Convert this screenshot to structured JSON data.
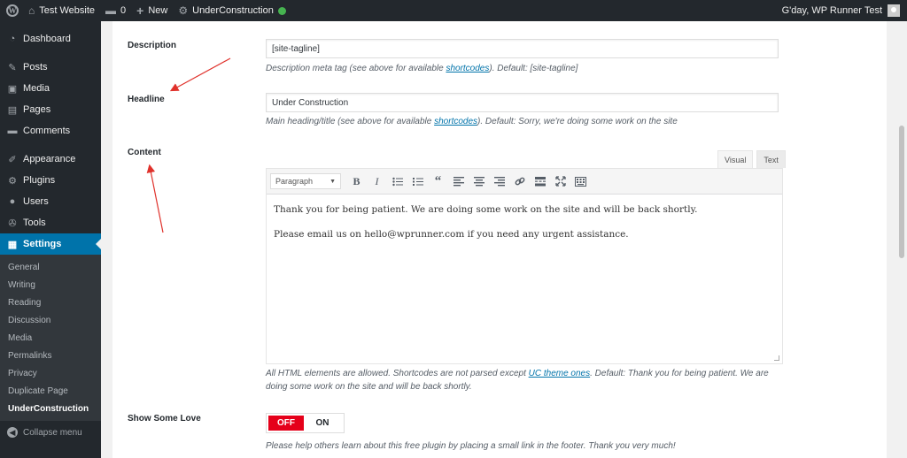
{
  "adminbar": {
    "site_name": "Test Website",
    "comments_count": "0",
    "new_label": "New",
    "plugin_label": "UnderConstruction",
    "greeting": "G'day, WP Runner Test"
  },
  "sidebar": {
    "items": [
      {
        "label": "Dashboard",
        "icon": "dashboard-icon",
        "glyph": "◔"
      },
      {
        "label": "Posts",
        "icon": "pin-icon",
        "glyph": "✎"
      },
      {
        "label": "Media",
        "icon": "media-icon",
        "glyph": "▣"
      },
      {
        "label": "Pages",
        "icon": "pages-icon",
        "glyph": "▤"
      },
      {
        "label": "Comments",
        "icon": "comment-icon",
        "glyph": "▬"
      },
      {
        "label": "Appearance",
        "icon": "brush-icon",
        "glyph": "✐"
      },
      {
        "label": "Plugins",
        "icon": "plug-icon",
        "glyph": "⚙"
      },
      {
        "label": "Users",
        "icon": "user-icon",
        "glyph": "●"
      },
      {
        "label": "Tools",
        "icon": "wrench-icon",
        "glyph": "✇"
      },
      {
        "label": "Settings",
        "icon": "settings-icon",
        "glyph": "▦"
      }
    ],
    "submenu": [
      "General",
      "Writing",
      "Reading",
      "Discussion",
      "Media",
      "Permalinks",
      "Privacy",
      "Duplicate Page",
      "UnderConstruction"
    ],
    "collapse_label": "Collapse menu"
  },
  "form": {
    "description": {
      "label": "Description",
      "value": "[site-tagline]",
      "help_pre": "Description meta tag (see above for available ",
      "help_link": "shortcodes",
      "help_post": "). Default: [site-tagline]"
    },
    "headline": {
      "label": "Headline",
      "value": "Under Construction",
      "help_pre": "Main heading/title (see above for available ",
      "help_link": "shortcodes",
      "help_post": "). Default: Sorry, we're doing some work on the site"
    },
    "content": {
      "label": "Content",
      "tab_visual": "Visual",
      "tab_text": "Text",
      "format": "Paragraph",
      "paragraph1": "Thank you for being patient. We are doing some work on the site and will be back shortly.",
      "paragraph2": "Please email us on hello@wprunner.com if you need any urgent assistance.",
      "help_pre": "All HTML elements are allowed. Shortcodes are not parsed except ",
      "help_link": "UC theme ones",
      "help_post": ". Default: Thank you for being patient. We are doing some work on the site and will be back shortly."
    },
    "show_love": {
      "label": "Show Some Love",
      "off": "OFF",
      "on": "ON",
      "help": "Please help others learn about this free plugin by placing a small link in the footer. Thank you very much!"
    }
  },
  "colors": {
    "accent": "#0073aa",
    "toggle_off": "#e5001a",
    "annotation_arrow": "#e0312b"
  }
}
